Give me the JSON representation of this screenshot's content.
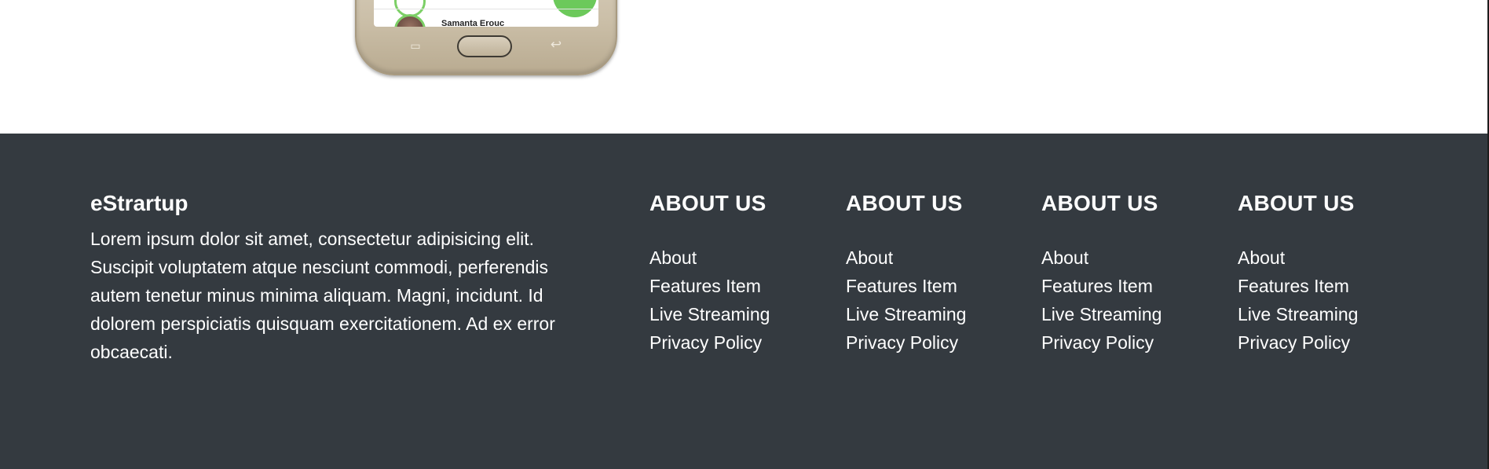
{
  "phone": {
    "contact_name": "Samanta Erouc"
  },
  "footer": {
    "brand": {
      "title": "eStrartup",
      "description": "Lorem ipsum dolor sit amet, consectetur adipisicing elit. Suscipit voluptatem atque nesciunt commodi, perferendis autem tenetur minus minima aliquam. Magni, incidunt. Id dolorem perspiciatis quisquam exercitationem. Ad ex error obcaecati."
    },
    "columns": [
      {
        "heading": "ABOUT US",
        "links": [
          "About",
          "Features Item",
          "Live Streaming",
          "Privacy Policy"
        ]
      },
      {
        "heading": "ABOUT US",
        "links": [
          "About",
          "Features Item",
          "Live Streaming",
          "Privacy Policy"
        ]
      },
      {
        "heading": "ABOUT US",
        "links": [
          "About",
          "Features Item",
          "Live Streaming",
          "Privacy Policy"
        ]
      },
      {
        "heading": "ABOUT US",
        "links": [
          "About",
          "Features Item",
          "Live Streaming",
          "Privacy Policy"
        ]
      }
    ]
  },
  "colors": {
    "footer_bg": "#343a40",
    "footer_text": "#ffffff",
    "accent_green": "#6cc95b"
  }
}
